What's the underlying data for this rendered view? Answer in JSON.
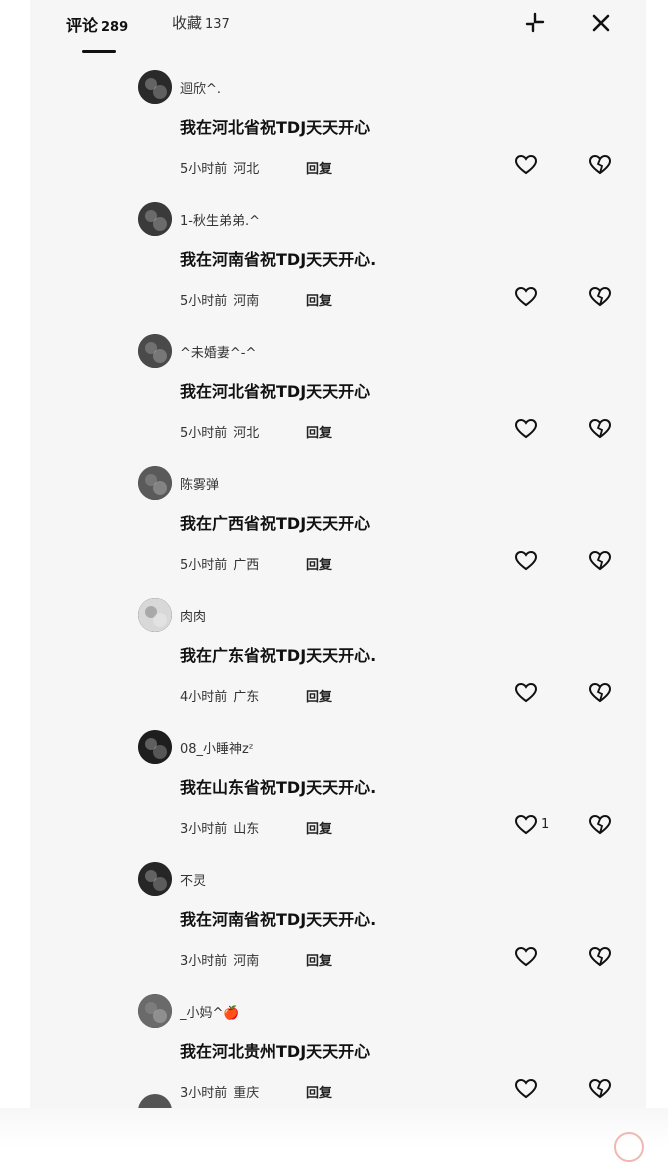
{
  "header": {
    "tab_comments_label": "评论",
    "tab_comments_count": "289",
    "tab_favorites_label": "收藏",
    "tab_favorites_count": "137",
    "collapse_icon": "collapse-icon",
    "close_icon": "close-icon"
  },
  "comments": [
    {
      "username": "迴欣^.",
      "text": "我在河北省祝TDJ天天开心",
      "time": "5小时前",
      "location": "河北",
      "reply_label": "回复",
      "likes": "",
      "avatar_color": "#2a2a2a"
    },
    {
      "username": "1-秋生弟弟.^",
      "text": "我在河南省祝TDJ天天开心.",
      "time": "5小时前",
      "location": "河南",
      "reply_label": "回复",
      "likes": "",
      "avatar_color": "#3a3a3a"
    },
    {
      "username": "^未婚妻^-^",
      "text": "我在河北省祝TDJ天天开心",
      "time": "5小时前",
      "location": "河北",
      "reply_label": "回复",
      "likes": "",
      "avatar_color": "#4a4a4a"
    },
    {
      "username": "陈雾弹",
      "text": "我在广西省祝TDJ天天开心",
      "time": "5小时前",
      "location": "广西",
      "reply_label": "回复",
      "likes": "",
      "avatar_color": "#5a5a5a"
    },
    {
      "username": "肉肉",
      "text": "我在广东省祝TDJ天天开心.",
      "time": "4小时前",
      "location": "广东",
      "reply_label": "回复",
      "likes": "",
      "avatar_color": "#d8d8d8"
    },
    {
      "username": "08_小睡神zᶻ",
      "text": "我在山东省祝TDJ天天开心.",
      "time": "3小时前",
      "location": "山东",
      "reply_label": "回复",
      "likes": "1",
      "avatar_color": "#1e1e1e"
    },
    {
      "username": "不灵",
      "text": "我在河南省祝TDJ天天开心.",
      "time": "3小时前",
      "location": "河南",
      "reply_label": "回复",
      "likes": "",
      "avatar_color": "#262626"
    },
    {
      "username": "_小妈^🍎",
      "text": "我在河北贵州TDJ天天开心",
      "time": "3小时前",
      "location": "重庆",
      "reply_label": "回复",
      "likes": "",
      "avatar_color": "#6a6a6a"
    }
  ]
}
